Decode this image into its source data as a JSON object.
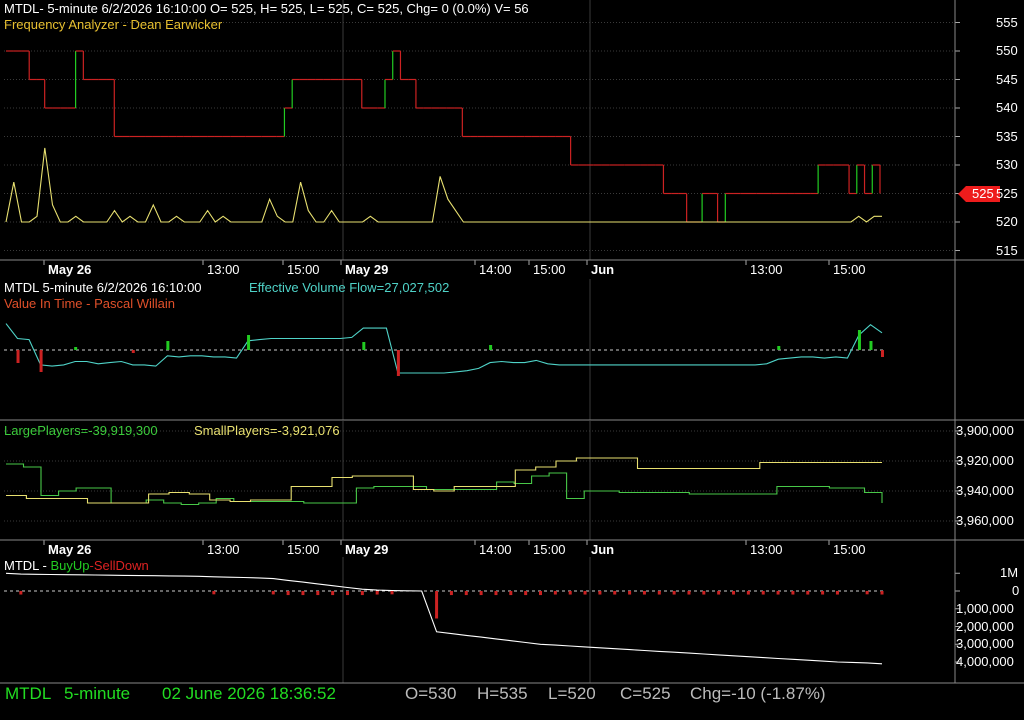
{
  "colors": {
    "background": "#000000",
    "grid": "#3a3a3a",
    "up": "#22cc22",
    "down": "#cc2222",
    "yellow": "#e8e070",
    "cyan": "#4fd3c8",
    "green_line": "#48c848",
    "white": "#ffffff",
    "status_green": "#22dd22",
    "status_gray": "#bbbbbb"
  },
  "panel1": {
    "header": "MTDL- 5-minute 6/2/2026 16:10:00 O= 525, H= 525, L= 525, C= 525, Chg= 0 (0.0%) V= 56",
    "indicator": "Frequency Analyzer - Dean Earwicker",
    "price_tag": "525",
    "y_ticks": [
      "555",
      "550",
      "545",
      "540",
      "535",
      "530",
      "525",
      "520",
      "515"
    ]
  },
  "date_axis_1": [
    "May 26",
    "13:00",
    "15:00",
    "May 29",
    "14:00",
    "15:00",
    "Jun",
    "13:00",
    "15:00"
  ],
  "panel2": {
    "header_symbol": "MTDL 5-minute  6/2/2026 16:10:00",
    "header_evf": "Effective Volume Flow=27,027,502",
    "indicator": "Value In Time - Pascal Willain"
  },
  "panel3": {
    "large_label": "LargePlayers=-39,919,300",
    "small_label": "SmallPlayers=-3,921,076",
    "y_ticks": [
      "3,900,000",
      "3,920,000",
      "3,940,000",
      "3,960,000"
    ]
  },
  "date_axis_2": [
    "May 26",
    "13:00",
    "15:00",
    "May 29",
    "14:00",
    "15:00",
    "Jun",
    "13:00",
    "15:00"
  ],
  "panel4": {
    "symbol": "MTDL",
    "sep": " - ",
    "buy": "BuyUp",
    "sep2": "-",
    "sell": "SellDown",
    "y_ticks": [
      "1M",
      "0",
      "1,000,000",
      "2,000,000",
      "3,000,000",
      "4,000,000"
    ]
  },
  "status": {
    "symbol": "MTDL",
    "interval": "5-minute",
    "datetime": "02 June 2026 18:36:52",
    "open": "O=530",
    "high": "H=535",
    "low": "L=520",
    "close": "C=525",
    "change": "Chg=-10 (-1.87%)"
  },
  "chart_data": [
    {
      "type": "line",
      "title": "Frequency Analyzer - Dean Earwicker",
      "ylim": [
        512,
        558
      ],
      "series": [
        {
          "name": "price_step",
          "values": [
            550,
            550,
            550,
            545,
            545,
            540,
            540,
            540,
            540,
            550,
            545,
            545,
            545,
            545,
            535,
            535,
            535,
            535,
            535,
            535,
            535,
            535,
            535,
            535,
            535,
            535,
            535,
            535,
            535,
            535,
            535,
            535,
            535,
            535,
            535,
            535,
            540,
            545,
            545,
            545,
            545,
            545,
            545,
            545,
            545,
            545,
            540,
            540,
            540,
            545,
            550,
            545,
            545,
            540,
            540,
            540,
            540,
            540,
            540,
            535,
            535,
            535,
            535,
            535,
            535,
            535,
            535,
            535,
            535,
            535,
            535,
            535,
            535,
            530,
            530,
            530,
            530,
            530,
            530,
            530,
            530,
            530,
            530,
            530,
            530,
            525,
            525,
            525,
            520,
            520,
            525,
            525,
            520,
            525,
            525,
            525,
            525,
            525,
            525,
            525,
            525,
            525,
            525,
            525,
            525,
            530,
            530,
            530,
            530,
            525,
            530,
            525,
            530,
            525
          ]
        },
        {
          "name": "oscillator",
          "values": [
            520,
            527,
            520,
            520,
            521,
            533,
            523,
            520,
            520,
            521,
            520,
            520,
            520,
            520,
            522,
            520,
            521,
            520,
            520,
            523,
            520,
            520,
            521,
            520,
            520,
            520,
            522,
            520,
            521,
            520,
            520,
            520,
            520,
            520,
            524,
            521,
            520,
            520,
            527,
            522,
            520,
            520,
            522,
            520,
            520,
            520,
            520,
            521,
            520,
            520,
            520,
            520,
            520,
            520,
            520,
            520,
            528,
            524,
            522,
            520,
            520,
            520,
            520,
            520,
            520,
            520,
            520,
            520,
            520,
            520,
            520,
            520,
            520,
            520,
            520,
            520,
            520,
            520,
            520,
            520,
            520,
            520,
            520,
            520,
            520,
            520,
            520,
            520,
            520,
            520,
            520,
            520,
            520,
            520,
            520,
            520,
            520,
            520,
            520,
            520,
            520,
            520,
            520,
            520,
            520,
            520,
            520,
            520,
            520,
            520,
            521,
            520,
            521,
            521
          ]
        }
      ]
    },
    {
      "type": "line",
      "title": "Value In Time - Pascal Willain",
      "ylim": [
        -3,
        3
      ],
      "series": [
        {
          "name": "evf",
          "values": [
            2.3,
            1.0,
            0.9,
            -1.3,
            -1.4,
            -1.3,
            -1.0,
            -1.0,
            -1.2,
            -1.1,
            -1.0,
            -1.3,
            -1.3,
            -1.4,
            -0.5,
            -0.6,
            -0.5,
            -0.5,
            -0.6,
            -0.6,
            -0.7,
            0.8,
            0.9,
            1.0,
            1.0,
            1.0,
            1.0,
            1.0,
            1.0,
            1.0,
            1.1,
            1.9,
            1.9,
            1.9,
            -2.0,
            -2.0,
            -2.0,
            -2.0,
            -2.0,
            -1.9,
            -1.8,
            -1.6,
            -1.1,
            -1.0,
            -1.1,
            -1.1,
            -0.9,
            -1.2,
            -1.3,
            -1.3,
            -1.3,
            -1.3,
            -1.3,
            -1.3,
            -1.3,
            -1.3,
            -1.3,
            -1.3,
            -1.3,
            -1.3,
            -1.3,
            -1.3,
            -1.3,
            -1.3,
            -1.3,
            -1.3,
            -1.2,
            -0.8,
            -0.7,
            -0.6,
            -0.6,
            -0.7,
            -0.6,
            -0.7,
            1.3,
            2.2,
            1.5
          ]
        }
      ]
    },
    {
      "type": "line",
      "title": "",
      "ylim": [
        3965000,
        3895000
      ],
      "series": [
        {
          "name": "LargePlayers",
          "values": [
            3922000,
            3924000,
            3943000,
            3940000,
            3938000,
            3938000,
            3948000,
            3948000,
            3946000,
            3948000,
            3949000,
            3948000,
            3945000,
            3947000,
            3947000,
            3947000,
            3947000,
            3948000,
            3948000,
            3948000,
            3938000,
            3937000,
            3937000,
            3937000,
            3939000,
            3939000,
            3939000,
            3939000,
            3934000,
            3935000,
            3930000,
            3928000,
            3945000,
            3940000,
            3940000,
            3941000,
            3941000,
            3941000,
            3941000,
            3942000,
            3942000,
            3942000,
            3942000,
            3942000,
            3937000,
            3937000,
            3937000,
            3938000,
            3938000,
            3941000,
            3948000
          ]
        },
        {
          "name": "SmallPlayers",
          "values": [
            3943000,
            3945000,
            3945000,
            3945000,
            3948000,
            3948000,
            3948000,
            3942000,
            3941000,
            3942000,
            3946000,
            3947000,
            3946000,
            3946000,
            3937000,
            3937000,
            3931000,
            3930000,
            3930000,
            3930000,
            3939000,
            3940000,
            3937000,
            3937000,
            3937000,
            3926000,
            3924000,
            3920000,
            3918000,
            3918000,
            3918000,
            3925000,
            3925000,
            3925000,
            3925000,
            3925000,
            3925000,
            3921000,
            3921000,
            3921000,
            3921000,
            3921000,
            3921000,
            3921000
          ]
        }
      ]
    },
    {
      "type": "line",
      "title": "",
      "ylim": [
        -4500000,
        1500000
      ],
      "series": [
        {
          "name": "cumulative",
          "values": [
            1000000,
            950000,
            940000,
            930000,
            920000,
            910000,
            900000,
            890000,
            880000,
            870000,
            860000,
            850000,
            840000,
            830000,
            800000,
            780000,
            760000,
            740000,
            700000,
            600000,
            500000,
            400000,
            300000,
            200000,
            100000,
            50000,
            20000,
            10000,
            0,
            -2300000,
            -2400000,
            -2500000,
            -2600000,
            -2700000,
            -2800000,
            -2900000,
            -3000000,
            -3050000,
            -3100000,
            -3150000,
            -3200000,
            -3250000,
            -3300000,
            -3350000,
            -3400000,
            -3450000,
            -3500000,
            -3550000,
            -3600000,
            -3650000,
            -3700000,
            -3750000,
            -3800000,
            -3850000,
            -3900000,
            -3950000,
            -4000000,
            -4020000,
            -4050000,
            -4100000
          ]
        }
      ]
    }
  ]
}
